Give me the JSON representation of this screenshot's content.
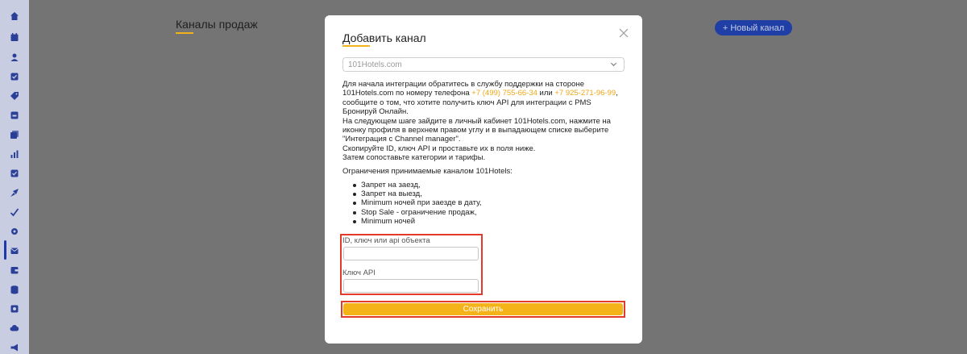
{
  "sidebar": {
    "icons": [
      "home-icon",
      "calendar-icon",
      "user-icon",
      "checklist-icon",
      "tag-icon",
      "bed-icon",
      "folder-icon",
      "chart-icon",
      "mail-check-icon",
      "rocket-icon",
      "edit-check-icon",
      "settings-icon",
      "channels-icon",
      "wallet-icon",
      "database-icon",
      "shield-icon",
      "cloud-icon",
      "megaphone-icon"
    ],
    "active_index": 12
  },
  "page": {
    "title": "Каналы продаж",
    "new_channel_button": "+ Новый канал"
  },
  "modal": {
    "title": "Добавить канал",
    "channel_select": {
      "value": "101Hotels.com"
    },
    "instructions": {
      "line1_prefix": "Для начала интеграции обратитесь в службу поддержки на стороне 101Hotels.com по номеру телефона ",
      "phone1": "+7 (499) 755-66-34",
      "or": " или ",
      "phone2": "+7 925-271-96-99",
      "line1_suffix": ", сообщите о том, что хотите получить ключ API для интеграции с PMS Бронируй Онлайн.",
      "line2": "На следующем шаге зайдите в личный кабинет 101Hotels.com, нажмите на иконку профиля в верхнем правом углу и в выпадающем списке выберите \"Интеграция с Channel manager\".",
      "line3": "Скопируйте ID, ключ API и проставьте их в поля ниже.",
      "line4": "Затем сопоставьте категории и тарифы."
    },
    "limits_title": "Ограничения принимаемые каналом 101Hotels:",
    "limits": [
      "Запрет на заезд,",
      "Запрет на выезд,",
      "Minimum ночей при заезде в дату,",
      "Stop Sale - ограничение продаж,",
      "Minimum ночей"
    ],
    "fields": {
      "id_label": "ID, ключ или api объекта",
      "id_value": "",
      "key_label": "Ключ API",
      "key_value": ""
    },
    "save_button": "Сохранить"
  },
  "colors": {
    "accent": "#f5b31a",
    "primary": "#1f3fa6",
    "highlight": "#e33a2a",
    "overlay": "#747474"
  }
}
